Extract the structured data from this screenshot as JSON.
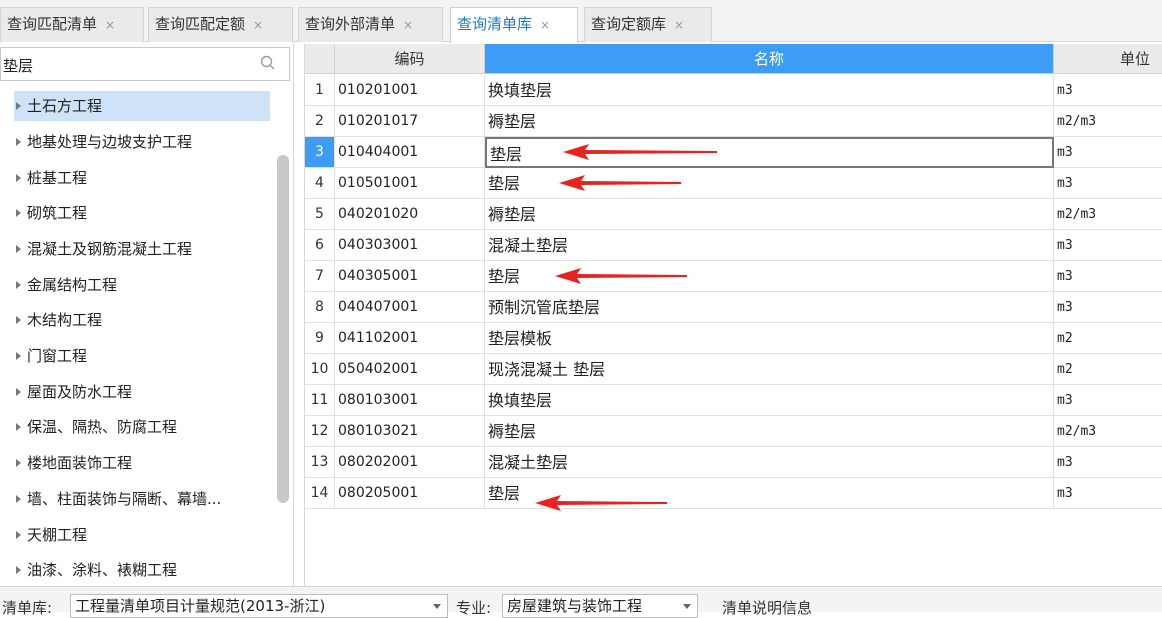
{
  "tabs": [
    {
      "label": "查询匹配清单",
      "close": "×"
    },
    {
      "label": "查询匹配定额",
      "close": "×"
    },
    {
      "label": "查询外部清单",
      "close": "×"
    },
    {
      "label": "查询清单库",
      "close": "×"
    },
    {
      "label": "查询定额库",
      "close": "×"
    }
  ],
  "active_tab": "查询清单库",
  "search": {
    "value": "垫层",
    "icon": "search-icon"
  },
  "tree": [
    "土石方工程",
    "地基处理与边坡支护工程",
    "桩基工程",
    "砌筑工程",
    "混凝土及钢筋混凝土工程",
    "金属结构工程",
    "木结构工程",
    "门窗工程",
    "屋面及防水工程",
    "保温、隔热、防腐工程",
    "楼地面装饰工程",
    "墙、柱面装饰与隔断、幕墙...",
    "天棚工程",
    "油漆、涂料、裱糊工程"
  ],
  "table": {
    "headers": {
      "code": "编码",
      "name": "名称",
      "unit": "单位"
    },
    "rows": [
      {
        "num": "1",
        "code": "010201001",
        "name": "换填垫层",
        "unit": "m3"
      },
      {
        "num": "2",
        "code": "010201017",
        "name": "褥垫层",
        "unit": "m2/m3"
      },
      {
        "num": "3",
        "code": "010404001",
        "name": "垫层",
        "unit": "m3"
      },
      {
        "num": "4",
        "code": "010501001",
        "name": "垫层",
        "unit": "m3"
      },
      {
        "num": "5",
        "code": "040201020",
        "name": "褥垫层",
        "unit": "m2/m3"
      },
      {
        "num": "6",
        "code": "040303001",
        "name": "混凝土垫层",
        "unit": "m3"
      },
      {
        "num": "7",
        "code": "040305001",
        "name": "垫层",
        "unit": "m3"
      },
      {
        "num": "8",
        "code": "040407001",
        "name": "预制沉管底垫层",
        "unit": "m3"
      },
      {
        "num": "9",
        "code": "041102001",
        "name": "垫层模板",
        "unit": "m2"
      },
      {
        "num": "10",
        "code": "050402001",
        "name": "现浇混凝土 垫层",
        "unit": "m2"
      },
      {
        "num": "11",
        "code": "080103001",
        "name": "换填垫层",
        "unit": "m3"
      },
      {
        "num": "12",
        "code": "080103021",
        "name": "褥垫层",
        "unit": "m2/m3"
      },
      {
        "num": "13",
        "code": "080202001",
        "name": "混凝土垫层",
        "unit": "m3"
      },
      {
        "num": "14",
        "code": "080205001",
        "name": "垫层",
        "unit": "m3"
      }
    ]
  },
  "bottom": {
    "library_label": "清单库:",
    "library_value": "工程量清单项目计量规范(2013-浙江)",
    "major_label": "专业:",
    "major_value": "房屋建筑与装饰工程",
    "info_label": "清单说明信息"
  },
  "colors": {
    "accent": "#3d9cf5",
    "annotation_arrow": "#e8231f",
    "tab_active_text": "#1e78d8"
  }
}
